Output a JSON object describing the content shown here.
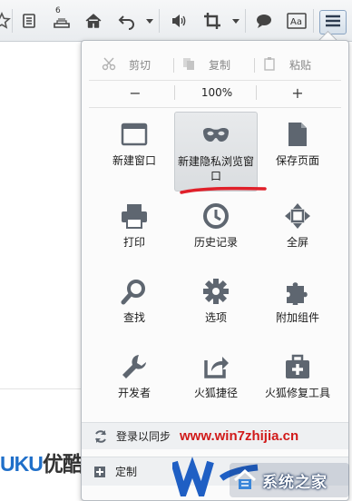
{
  "toolbar": {
    "badge": "6",
    "icons": [
      "star-icon",
      "reader-icon",
      "download-icon",
      "home-icon",
      "back-icon",
      "dropdown-icon",
      "volume-icon",
      "crop-icon",
      "dropdown-icon",
      "chat-icon",
      "translate-icon",
      "menu-icon"
    ],
    "translate_label": "Aa"
  },
  "panel": {
    "edit": {
      "cut": "剪切",
      "copy": "复制",
      "paste": "粘贴"
    },
    "zoom": {
      "minus": "−",
      "value": "100%",
      "plus": "+"
    },
    "items": [
      {
        "label": "新建窗口",
        "icon": "new-window-icon"
      },
      {
        "label": "新建隐私浏览窗口",
        "icon": "private-mask-icon"
      },
      {
        "label": "保存页面",
        "icon": "save-page-icon"
      },
      {
        "label": "打印",
        "icon": "print-icon"
      },
      {
        "label": "历史记录",
        "icon": "history-clock-icon"
      },
      {
        "label": "全屏",
        "icon": "fullscreen-icon"
      },
      {
        "label": "查找",
        "icon": "find-magnifier-icon"
      },
      {
        "label": "选项",
        "icon": "options-gear-icon"
      },
      {
        "label": "附加组件",
        "icon": "addons-puzzle-icon"
      },
      {
        "label": "开发者",
        "icon": "developer-wrench-icon"
      },
      {
        "label": "火狐捷径",
        "icon": "shortcut-arrow-icon"
      },
      {
        "label": "火狐修复工具",
        "icon": "repair-toolbox-icon"
      }
    ],
    "sync": "登录以同步",
    "customize": "定制"
  },
  "page": {
    "logo_part1": "UKU",
    "logo_part2": "优酷"
  },
  "watermark": {
    "site": "www.win7zhijia.cn",
    "brand": "系统之家"
  },
  "colors": {
    "accent": "#1f6fc9",
    "highlight_underline": "#e0202a",
    "icon_gray": "#5e6670"
  }
}
